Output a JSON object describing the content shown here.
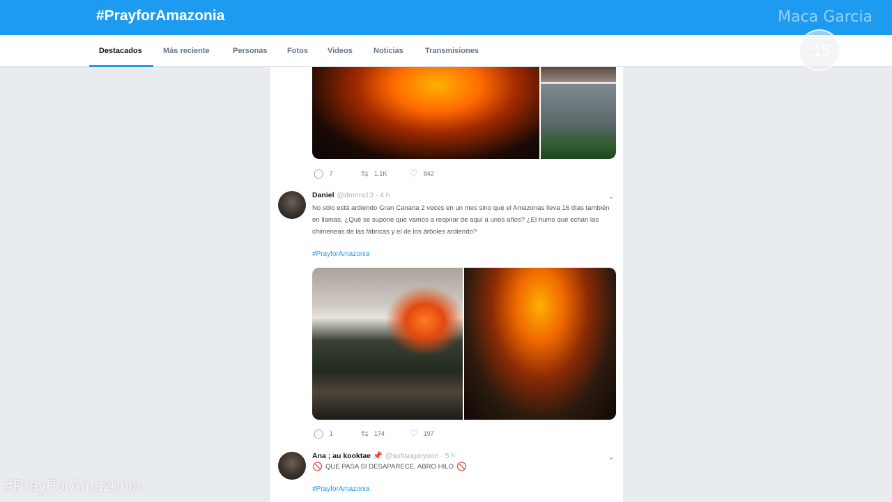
{
  "header": {
    "title": "#PrayforAmazonia",
    "overlay_name": "Maca Garcia",
    "timer": ":15"
  },
  "tabs": [
    {
      "label": "Destacados",
      "active": true
    },
    {
      "label": "Más reciente"
    },
    {
      "label": "Personas"
    },
    {
      "label": "Fotos"
    },
    {
      "label": "Videos"
    },
    {
      "label": "Noticias"
    },
    {
      "label": "Transmisiones"
    }
  ],
  "prev_tweet": {
    "replies": "7",
    "retweets": "1.1K",
    "likes": "842"
  },
  "tweets": [
    {
      "name": "Daniel",
      "handle": "@dmera13 · 4 h",
      "text": "No sólo está ardiendo Gran Canaria 2 veces en un mes sino que el Amazonas lleva 16 días también en llamas. ¿Qué se supone que vamos a respirar de aquí a unos años? ¿El humo que echan las chimeneas de las fábricas y el de los árboles ardiendo?",
      "hashtag": "#PrayforAmazonia",
      "replies": "1",
      "retweets": "174",
      "likes": "197"
    },
    {
      "name": "Ana ; au kooktae",
      "handle": "@softsugaryoon · 5 h",
      "text": "QUE PASA SI DESAPARECE. ABRO HILO",
      "hashtag": "#PrayforAmazonia"
    }
  ],
  "overlay_hashtag": "#PrayForAmazonia",
  "colors": {
    "brand": "#1c9bf0",
    "background": "#e8ecf0"
  },
  "icons": {
    "reply": "speech-bubble",
    "retweet": "retweet-arrows",
    "like": "heart",
    "menu": "chevron-down"
  }
}
